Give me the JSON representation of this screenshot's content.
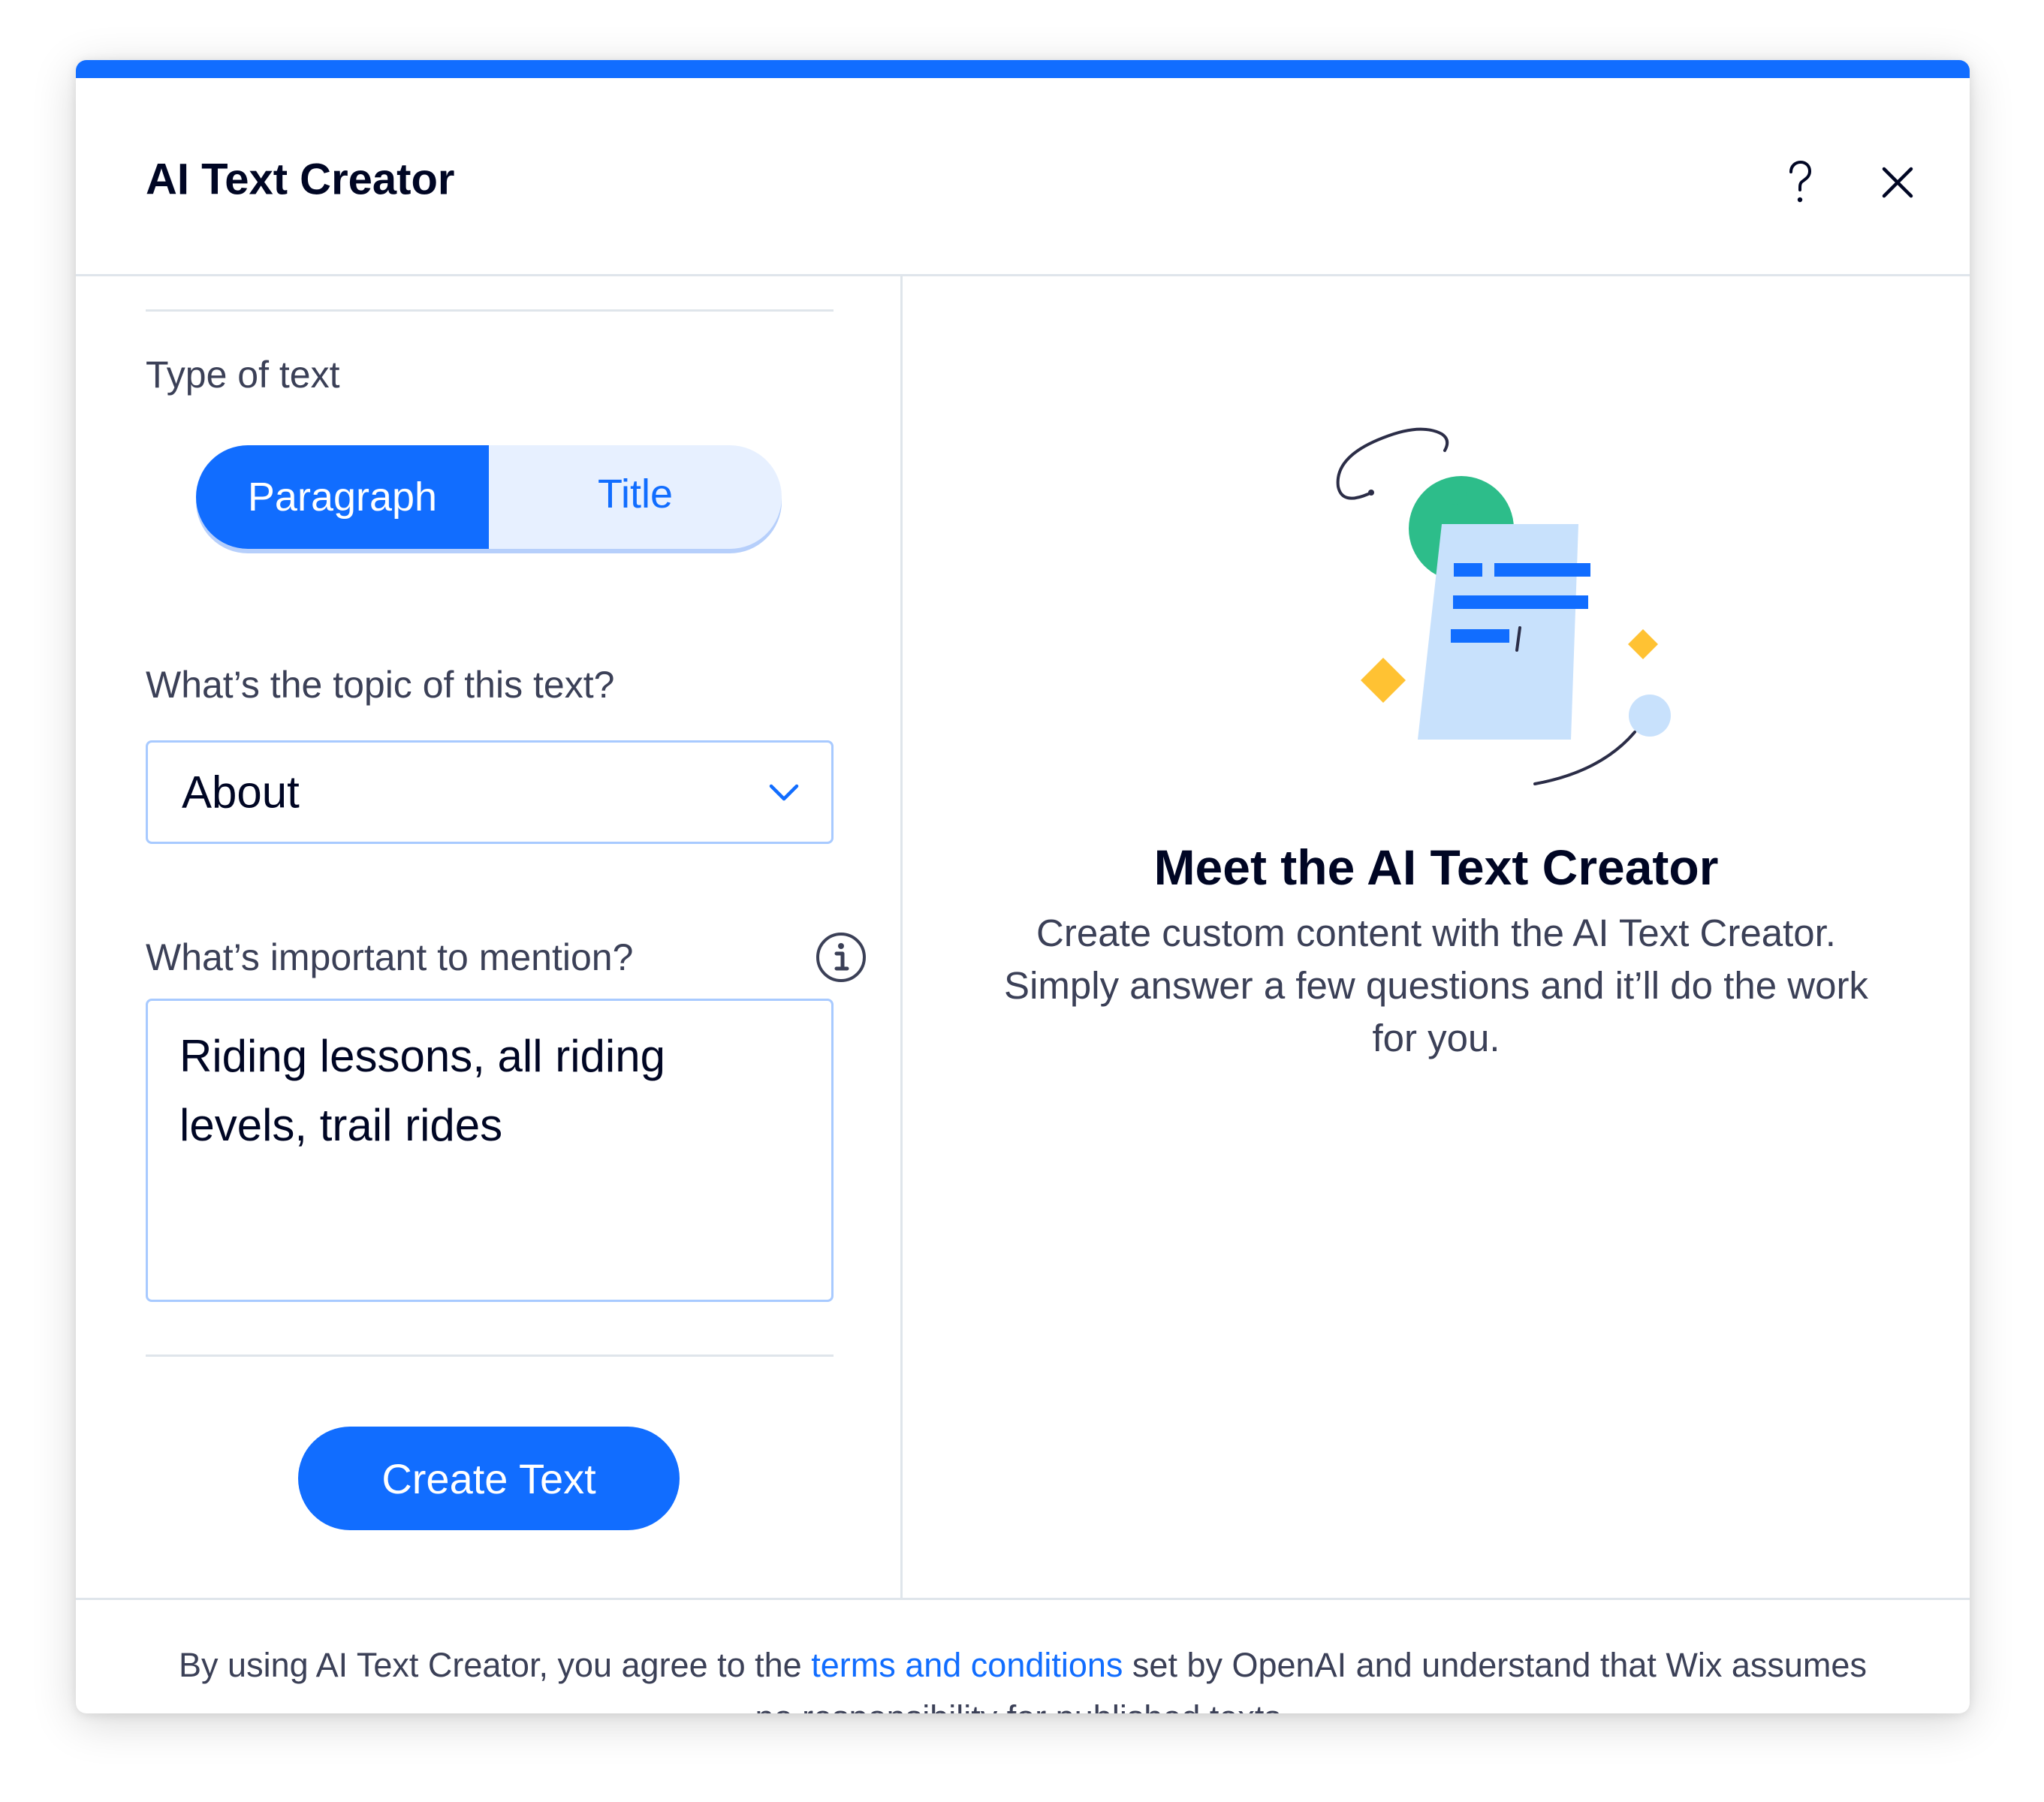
{
  "dialog": {
    "title": "AI Text Creator",
    "help_icon": "question-mark-icon",
    "close_icon": "close-icon",
    "accent_color": "#116dff"
  },
  "form": {
    "type_label": "Type of text",
    "type_options": [
      "Paragraph",
      "Title"
    ],
    "type_selected": "Paragraph",
    "topic_label": "What’s the topic of this text?",
    "topic_value": "About",
    "mention_label": "What’s important to mention?",
    "mention_value": "Riding lessons, all riding levels, trail rides",
    "info_icon": "info-icon",
    "create_button": "Create Text"
  },
  "intro": {
    "illustration": "document-illustration",
    "title": "Meet the AI Text Creator",
    "description": "Create custom content with the AI Text Creator. Simply answer a few questions and it’ll do the work for you."
  },
  "footer": {
    "text_before": "By using AI Text Creator, you agree to the ",
    "link": "terms and conditions",
    "text_after": " set by OpenAI and understand that Wix assumes no responsibility for published texts."
  }
}
